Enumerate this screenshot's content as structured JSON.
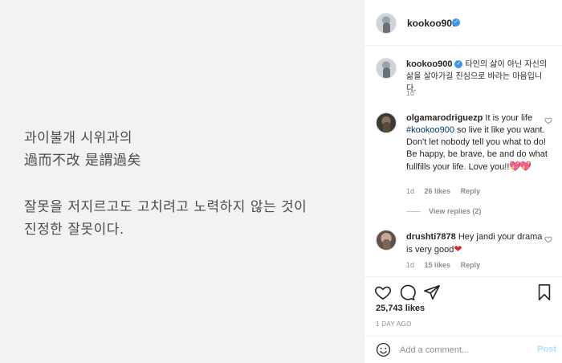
{
  "image": {
    "line1": "과이불개 시위과의",
    "line2": "過而不改 是謂過矣",
    "line3": "잘못을 저지르고도 고치려고 노력하지 않는 것이",
    "line4": "진정한 잘못이다."
  },
  "header": {
    "username": "kookoo900",
    "verified": "✓"
  },
  "caption": {
    "username": "kookoo900",
    "verified": "✓",
    "text": "타인의 삶이 아닌 자신의 삶을 살아가길 진심으로 바라는 마음입니다.",
    "time": "1d"
  },
  "comments": [
    {
      "username": "olgamarodriguezp",
      "mention": "#kookoo900",
      "text_before": "It is your life",
      "text_after": "so live it like you want. Don't let nobody tell you what to do! Be happy, be brave, be and do what fullfills your life. Love you!!",
      "emoji": "💖💖",
      "time": "1d",
      "likes": "26 likes",
      "reply": "Reply",
      "view_replies": "View replies (2)"
    },
    {
      "username": "drushti7878",
      "text": "Hey jandi your drama is very good",
      "emoji": "❤",
      "time": "1d",
      "likes": "15 likes",
      "reply": "Reply"
    }
  ],
  "actions": {
    "likes": "25,743 likes",
    "date": "1 DAY AGO"
  },
  "comment_box": {
    "placeholder": "Add a comment...",
    "post_label": "Post"
  },
  "colors": {
    "verified": "#3897f0",
    "post_disabled": "#b2dffc",
    "mention": "#00376b"
  }
}
